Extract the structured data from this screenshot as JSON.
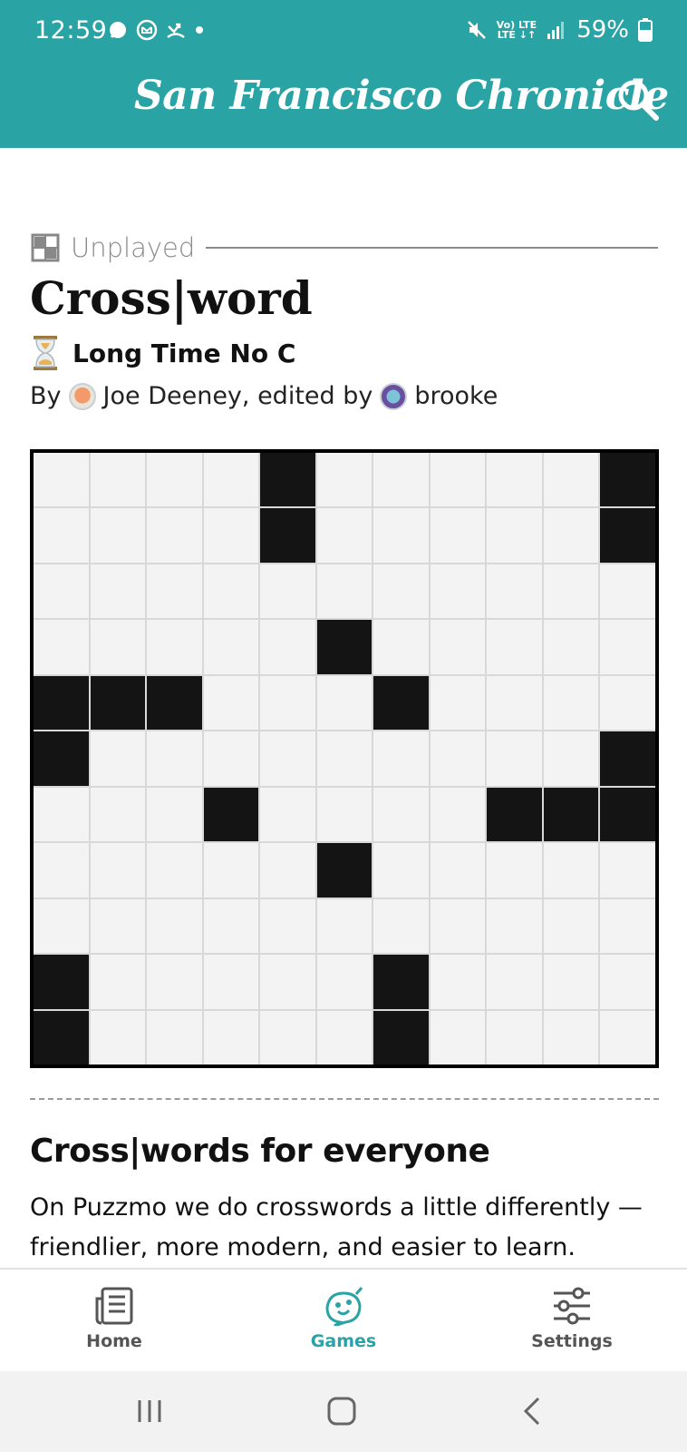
{
  "status_bar": {
    "time": "12:59",
    "battery": "59%",
    "network_top": "Vo) LTE",
    "network_bottom": "LTE ↓↑"
  },
  "header": {
    "brand": "San Francisco Chronicle",
    "search_icon": "search-icon"
  },
  "puzzle": {
    "status": "Unplayed",
    "title": "Cross|word",
    "name": "Long Time No C",
    "by_label": "By",
    "author": "Joe Deeney, edited by",
    "editor": "brooke"
  },
  "grid": {
    "size": 11,
    "rows": [
      "....#.....#",
      "....#.....#",
      "...........",
      ".....#.....",
      "###...#....",
      "#.........#",
      "...#....###",
      ".....#.....",
      "...........",
      "#.....#....",
      "#.....#...."
    ]
  },
  "promo": {
    "title": "Cross|words for everyone",
    "body": "On Puzzmo we do crosswords a little differently — friendlier, more modern, and easier to learn."
  },
  "tabs": [
    {
      "label": "Home",
      "icon": "newspaper-icon",
      "active": false
    },
    {
      "label": "Games",
      "icon": "puzzmo-face-icon",
      "active": true
    },
    {
      "label": "Settings",
      "icon": "sliders-icon",
      "active": false
    }
  ],
  "colors": {
    "accent": "#2aa3a5",
    "cell_fill": "#f3f3f3",
    "block": "#141414"
  }
}
